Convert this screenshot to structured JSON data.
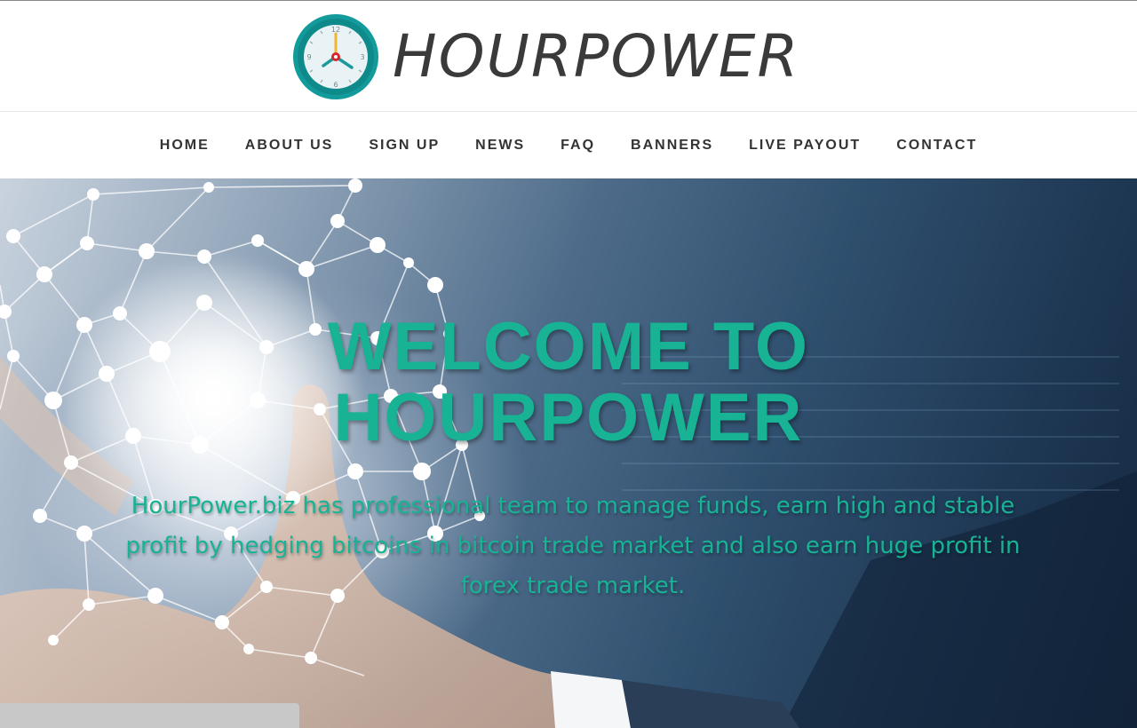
{
  "brand": {
    "name": "HOURPOWER",
    "colors": {
      "accent": "#17b394",
      "logo_ring": "#139a9a",
      "text_dark": "#3a3a3a"
    }
  },
  "nav": {
    "items": [
      {
        "label": "HOME"
      },
      {
        "label": "ABOUT US"
      },
      {
        "label": "SIGN UP"
      },
      {
        "label": "NEWS"
      },
      {
        "label": "FAQ"
      },
      {
        "label": "BANNERS"
      },
      {
        "label": "LIVE PAYOUT"
      },
      {
        "label": "CONTACT"
      }
    ]
  },
  "hero": {
    "title_line1": "WELCOME TO",
    "title_line2": "HOURPOWER",
    "description": "HourPower.biz has professional team to manage funds, earn high and stable profit by hedging bitcoins in bitcoin trade market and also earn huge profit in forex trade market."
  },
  "icons": {
    "logo": "clock-icon"
  }
}
